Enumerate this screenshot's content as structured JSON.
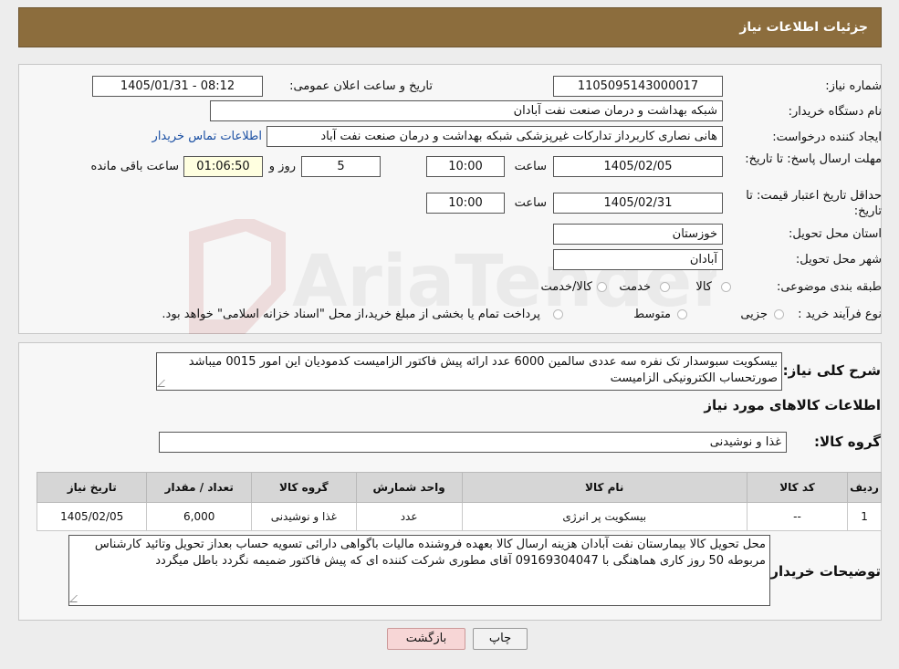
{
  "page": {
    "title": "جزئیات اطلاعات نیاز"
  },
  "info": {
    "need_number_label": "شماره نیاز:",
    "need_number": "1105095143000017",
    "announce_label": "تاریخ و ساعت اعلان عمومی:",
    "announce_value": "1405/01/31 - 08:12",
    "buyer_org_label": "نام دستگاه خریدار:",
    "buyer_org": "شبکه بهداشت و درمان صنعت نفت آبادان",
    "creator_label": "ایجاد کننده درخواست:",
    "creator": "هانی نصاری کاربرداز تدارکات غیرپزشکی شبکه بهداشت و درمان صنعت نفت آباد",
    "contact_link": "اطلاعات تماس خریدار",
    "deadline_label": "مهلت ارسال پاسخ: تا تاریخ:",
    "deadline_date": "1405/02/05",
    "time_label": "ساعت",
    "deadline_time": "10:00",
    "days_value": "5",
    "days_label": "روز و",
    "remaining_time": "01:06:50",
    "remaining_label": "ساعت باقی مانده",
    "validity_label": "حداقل تاریخ اعتبار قیمت: تا تاریخ:",
    "validity_date": "1405/02/31",
    "validity_time": "10:00",
    "province_label": "استان محل تحویل:",
    "province": "خوزستان",
    "city_label": "شهر محل تحویل:",
    "city": "آبادان",
    "category_label": "طبقه بندی موضوعی:",
    "category_options": [
      "کالا",
      "خدمت",
      "کالا/خدمت"
    ],
    "process_label": "نوع فرآیند خرید :",
    "process_options": [
      "جزیی",
      "متوسط"
    ],
    "process_note": "پرداخت تمام یا بخشی از مبلغ خرید،از محل \"اسناد خزانه اسلامی\" خواهد بود."
  },
  "summary": {
    "label": "شرح کلی نیاز:",
    "text": "بیسکویت سبوسدار  تک نفره سه عددی سالمین 6000 عدد ارائه پیش فاکتور الزامیست کدمودیان این امور 0015 میباشد صورتحساب الکترونیکی الزامیست"
  },
  "goods": {
    "section_title": "اطلاعات کالاهای مورد نیاز",
    "group_label": "گروه کالا:",
    "group_value": "غذا و نوشیدنی",
    "columns": [
      "ردیف",
      "کد کالا",
      "نام کالا",
      "واحد شمارش",
      "گروه کالا",
      "تعداد / مقدار",
      "تاریخ نیاز"
    ],
    "rows": [
      [
        "1",
        "--",
        "بیسکویت پر انرژی",
        "عدد",
        "غذا و نوشیدنی",
        "6,000",
        "1405/02/05"
      ]
    ]
  },
  "buyer_notes": {
    "label": "توضیحات خریدار:",
    "text": "محل تحویل کالا بیمارستان نفت آبادان هزینه ارسال کالا بعهده فروشنده مالیات باگواهی دارائی تسویه حساب بعداز تحویل وتائید کارشناس مربوطه 50 روز کاری هماهنگی با 09169304047 آقای مطوری شرکت کننده ای که پیش فاکتور ضمیمه نگردد باطل میگردد"
  },
  "buttons": {
    "print": "چاپ",
    "back": "بازگشت"
  },
  "watermark": {
    "text": "AriaTender.neT"
  },
  "colors": {
    "header": "#8c6d3d",
    "link": "#1a4fa3",
    "remaining_bg": "#ffffe0",
    "back_btn": "#f7d6d6"
  }
}
